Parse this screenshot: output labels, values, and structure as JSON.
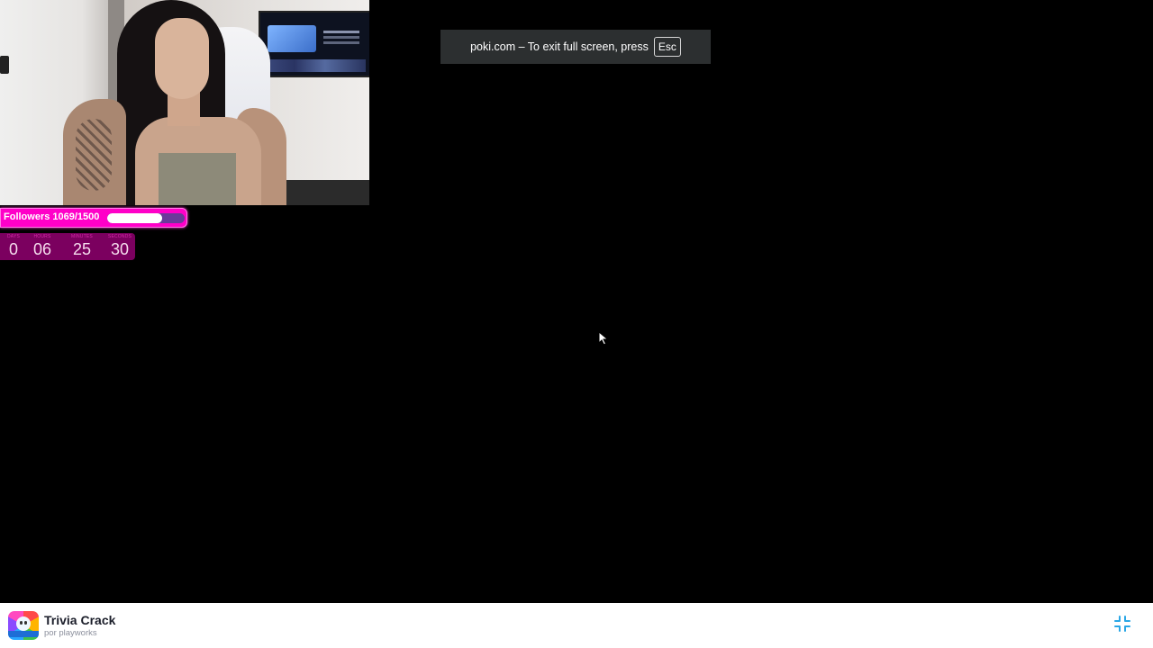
{
  "webcam": {
    "followers": {
      "label": "Followers 1069/1500",
      "current": 1069,
      "goal": 1500,
      "progress_fraction": 0.713
    },
    "countdown": [
      {
        "unit": "days",
        "value": "0"
      },
      {
        "unit": "hours",
        "value": "06"
      },
      {
        "unit": "minutes",
        "value": "25"
      },
      {
        "unit": "seconds",
        "value": "30"
      }
    ]
  },
  "fullscreen_notice": {
    "text": "poki.com – To exit full screen, press",
    "key": "Esc"
  },
  "bottom_bar": {
    "game_title": "Trivia Crack",
    "game_subtitle": "por playworks",
    "exit_fullscreen_icon": "compress-icon"
  },
  "colors": {
    "followers_bar": "#ff00c8",
    "countdown_bg": "#7b005f",
    "notice_bg": "#2c2f30",
    "bottom_bar_bg": "#ffffff",
    "exit_icon": "#2aa7e6"
  }
}
